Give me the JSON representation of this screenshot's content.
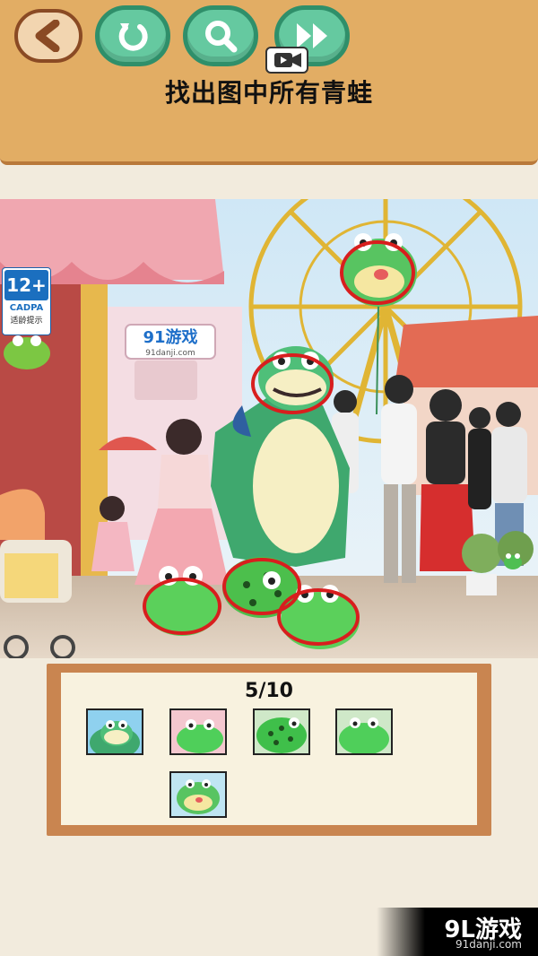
{
  "header": {
    "title": "找出图中所有青蛙",
    "buttons": {
      "back": "back-arrow-icon",
      "restart": "restart-icon",
      "hint": "magnifier-icon",
      "skip": "fast-forward-icon",
      "video": "video-camera-icon"
    }
  },
  "scene": {
    "sign_logo": "91游戏",
    "sign_url": "91danji.com",
    "found_marks": 5
  },
  "age_rating": {
    "rating": "12+",
    "org": "CADPA",
    "note": "适龄提示"
  },
  "progress": {
    "found": 5,
    "total": 10,
    "counter_text": "5/10"
  },
  "found_items": [
    {
      "name": "frog-costume"
    },
    {
      "name": "pink-frog"
    },
    {
      "name": "spotted-frog"
    },
    {
      "name": "green-frog"
    },
    {
      "name": "balloon-frog"
    }
  ],
  "watermark": {
    "logo": "9L游戏",
    "url": "91danji.com"
  },
  "colors": {
    "header_bg": "#e2ad64",
    "button_green": "#65c9a0",
    "panel_frame": "#c98550",
    "panel_bg": "#f8f2df",
    "found_circle": "#d81e1e"
  }
}
